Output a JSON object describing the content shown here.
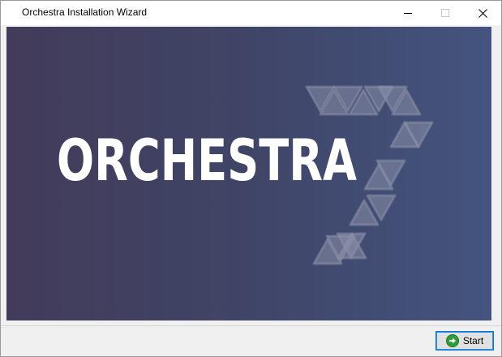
{
  "window": {
    "title": "Orchestra Installation Wizard"
  },
  "titlebar_buttons": {
    "minimize_icon": "minimize-icon",
    "maximize_icon": "maximize-icon",
    "close_icon": "close-icon"
  },
  "banner": {
    "logo_text": "ORCHESTRA",
    "logo_mark": "seven-triangles-logo",
    "colors": {
      "gradient_left": "#433b5a",
      "gradient_right": "#44547f",
      "logo_text": "#ffffff",
      "triangle": "#8a8fa8"
    }
  },
  "footer": {
    "start_label": "Start",
    "start_icon": "arrow-right-circle-icon",
    "start_icon_color": "#2e9e3a"
  }
}
